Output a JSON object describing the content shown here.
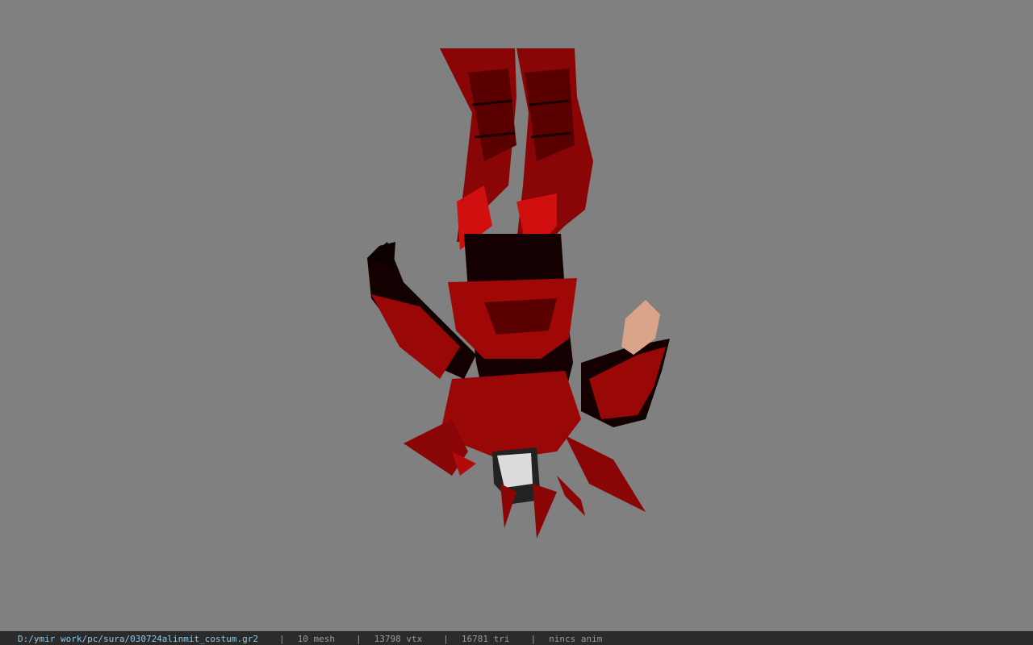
{
  "viewport": {
    "background": "#808080",
    "model_colors": {
      "armor_red": "#b30a0a",
      "armor_dark": "#5a0000",
      "cloth_black": "#120000",
      "skin": "#d9a48a"
    }
  },
  "statusbar": {
    "file_path": "D:/ymir work/pc/sura/030724alinmit_costum.gr2",
    "separator": "|",
    "mesh": "10 mesh",
    "vertices": "13798 vtx",
    "triangles": "16781 tri",
    "anim": "nincs anim"
  }
}
